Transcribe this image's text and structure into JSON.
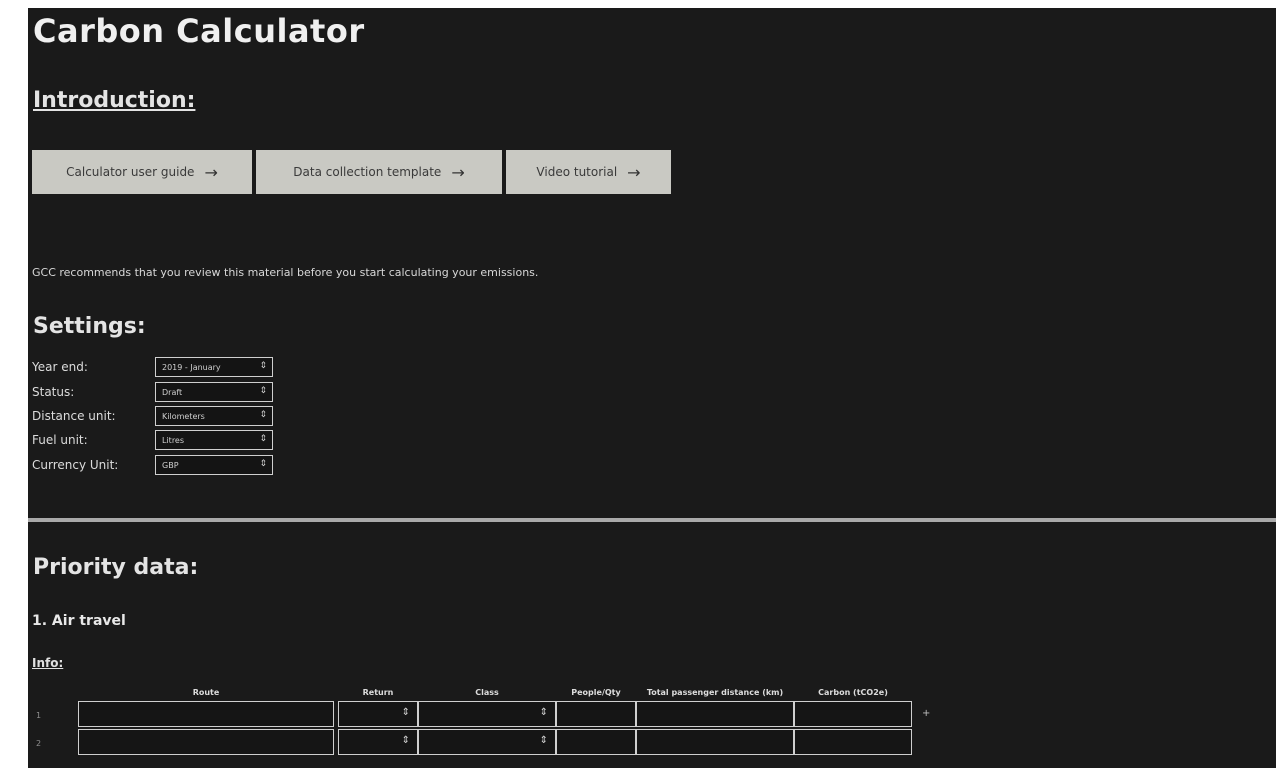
{
  "page": {
    "title": "Carbon Calculator"
  },
  "intro": {
    "heading": "Introduction:",
    "buttons": [
      {
        "label": "Calculator user guide",
        "icon": "arrow-right-icon"
      },
      {
        "label": "Data collection template",
        "icon": "arrow-right-icon"
      },
      {
        "label": "Video tutorial",
        "icon": "arrow-right-icon"
      }
    ],
    "note": "GCC recommends that you review this material before you start calculating your emissions."
  },
  "settings": {
    "heading": "Settings:",
    "rows": [
      {
        "label": "Year end:",
        "value": "2019 - January"
      },
      {
        "label": "Status:",
        "value": "Draft"
      },
      {
        "label": "Distance unit:",
        "value": "Kilometers"
      },
      {
        "label": "Fuel unit:",
        "value": "Litres"
      },
      {
        "label": "Currency Unit:",
        "value": "GBP"
      }
    ]
  },
  "priority": {
    "heading": "Priority data:",
    "air_travel": {
      "title": "1. Air travel",
      "info_label": "Info:",
      "columns": [
        "Route",
        "Return",
        "Class",
        "People/Qty",
        "Total passenger distance (km)",
        "Carbon (tCO2e)"
      ],
      "rows": [
        {
          "num": "1",
          "route": "",
          "return": "",
          "class": "",
          "people": "",
          "distance": "",
          "carbon": ""
        },
        {
          "num": "2",
          "route": "",
          "return": "",
          "class": "",
          "people": "",
          "distance": "",
          "carbon": ""
        }
      ],
      "add_label": "+"
    }
  },
  "colors": {
    "panel_bg": "#1a1a1a",
    "button_bg": "#c9c9c3",
    "text": "#e8e8e8",
    "divider": "#a9a9a9"
  }
}
